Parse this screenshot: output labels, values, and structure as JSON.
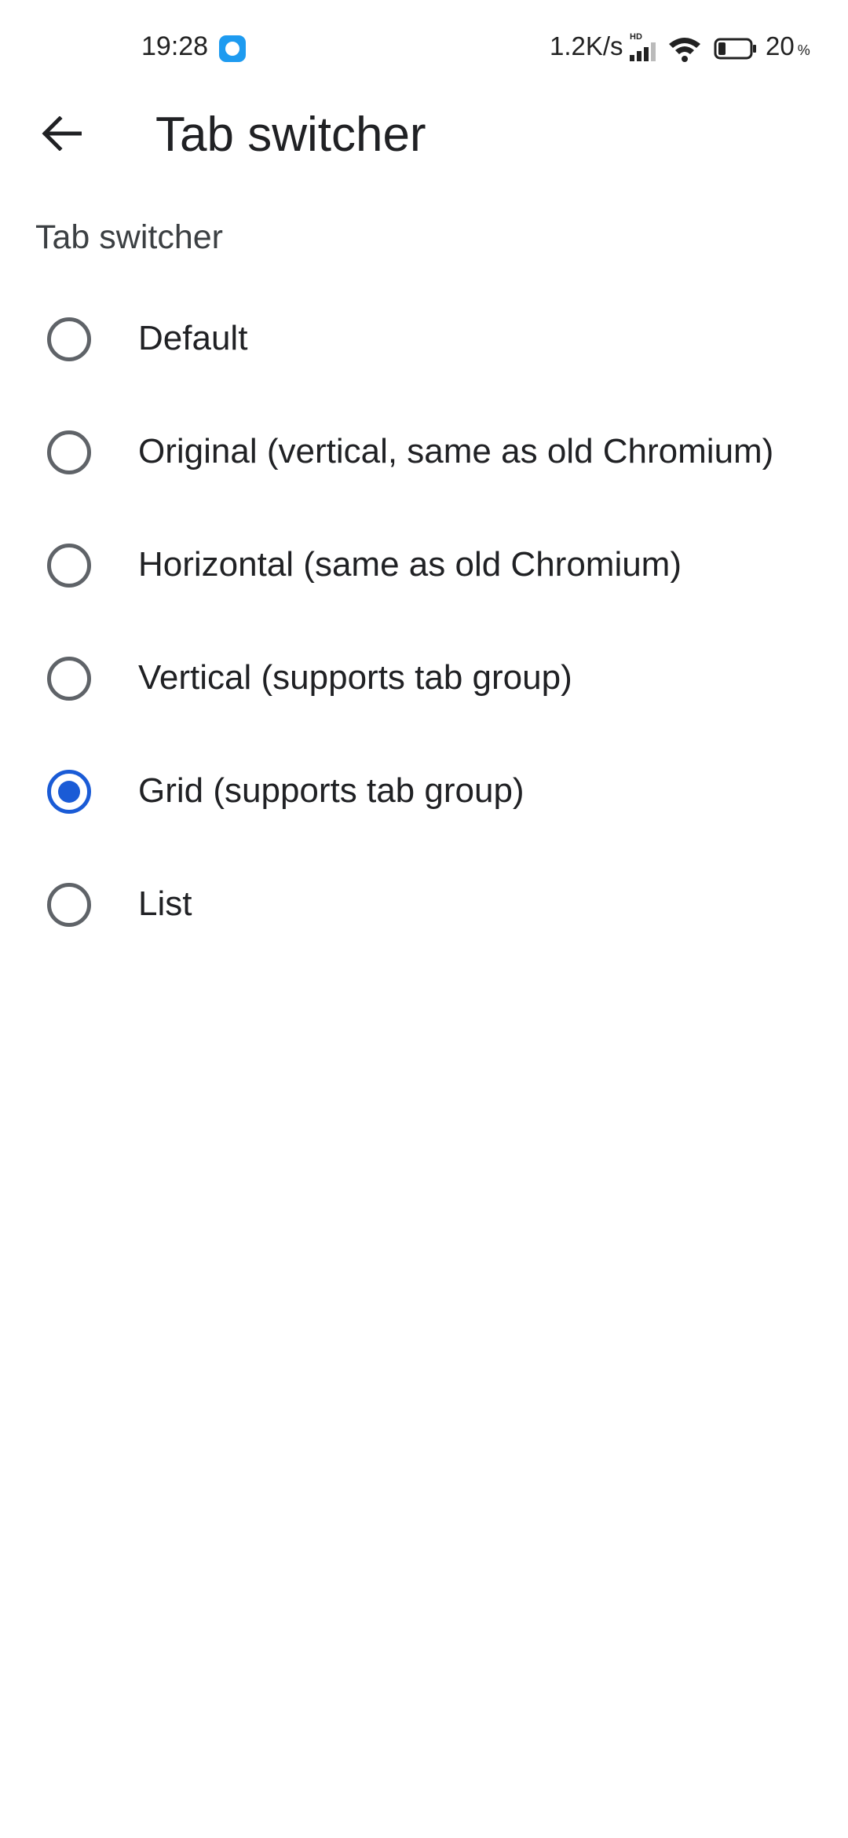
{
  "status_bar": {
    "time": "19:28",
    "net_speed": "1.2K/s",
    "network_badge": "HD",
    "battery_percent": "20",
    "battery_unit": "%",
    "battery_level": 0.2,
    "icons": [
      "app-notification-icon",
      "signal-icon",
      "wifi-icon",
      "battery-icon"
    ]
  },
  "toolbar": {
    "title": "Tab switcher",
    "back_icon": "arrow-back-icon"
  },
  "section": {
    "header": "Tab switcher"
  },
  "options": [
    {
      "label": "Default",
      "selected": false
    },
    {
      "label": "Original (vertical, same as old Chromium)",
      "selected": false
    },
    {
      "label": "Horizontal (same as old Chromium)",
      "selected": false
    },
    {
      "label": "Vertical (supports tab group)",
      "selected": false
    },
    {
      "label": "Grid (supports tab group)",
      "selected": true
    },
    {
      "label": "List",
      "selected": false
    }
  ],
  "colors": {
    "accent": "#1a5bd6",
    "radio_unchecked": "#5f6368",
    "text": "#202124",
    "background": "#ffffff"
  }
}
